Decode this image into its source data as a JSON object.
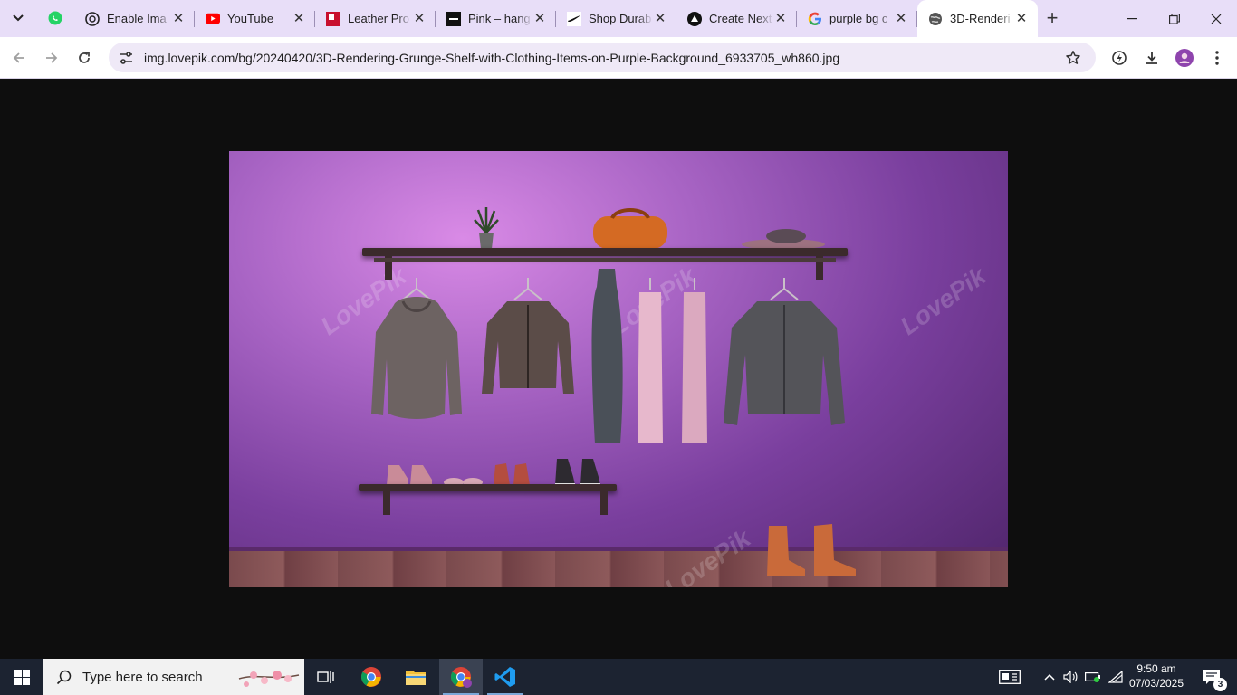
{
  "browser": {
    "tabs": [
      {
        "title": "Enable Ima",
        "icon": "openai-icon"
      },
      {
        "title": "YouTube",
        "icon": "youtube-icon"
      },
      {
        "title": "Leather Pro",
        "icon": "store-icon"
      },
      {
        "title": "Pink – hang",
        "icon": "brand-icon"
      },
      {
        "title": "Shop Durab",
        "icon": "nike-icon"
      },
      {
        "title": "Create Next",
        "icon": "vercel-icon"
      },
      {
        "title": "purple bg c",
        "icon": "google-icon"
      },
      {
        "title": "3D-Renderi",
        "icon": "globe-icon",
        "active": true
      }
    ],
    "close_symbol": "✕",
    "new_tab_symbol": "+",
    "url": "img.lovepik.com/bg/20240420/3D-Rendering-Grunge-Shelf-with-Clothing-Items-on-Purple-Background_6933705_wh860.jpg"
  },
  "image": {
    "watermarks": [
      "LovePik",
      "LovePik",
      "LovePik",
      "LovePik"
    ]
  },
  "taskbar": {
    "search_placeholder": "Type here to search",
    "time": "9:50 am",
    "date": "07/03/2025",
    "notification_count": "3"
  },
  "colors": {
    "tab_strip": "#e8def8",
    "accent": "#7a3f9e",
    "taskbar": "#1c2331"
  }
}
